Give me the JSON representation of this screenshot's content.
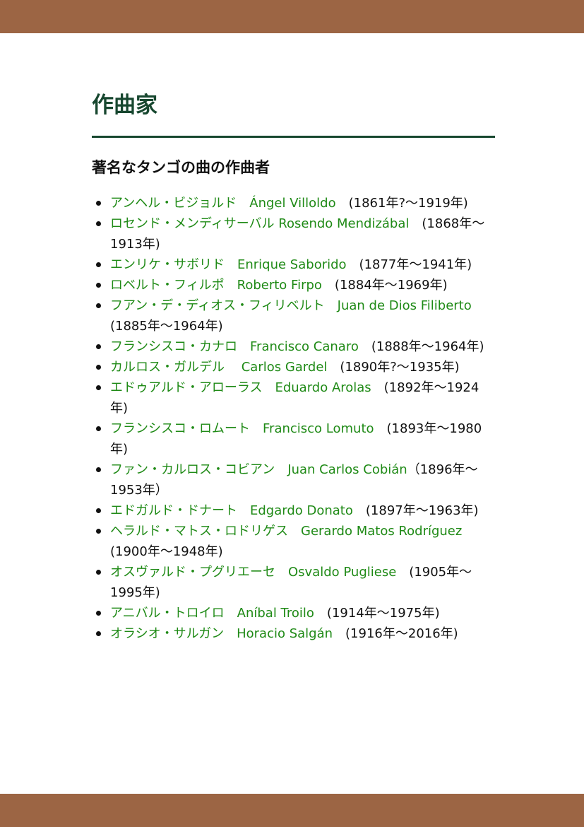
{
  "colors": {
    "band": "#9c6544",
    "title": "#17472f",
    "rule": "#17472f",
    "link": "#1f8a16",
    "text": "#111111"
  },
  "page": {
    "title": "作曲家",
    "section_title": "著名なタンゴの曲の作曲者"
  },
  "composers": [
    {
      "name": "アンヘル・ビジョルド　Ángel Villoldo",
      "years": "　(1861年?～1919年)"
    },
    {
      "name": "ロセンド・メンディサーバル Rosendo Mendizábal",
      "years": "　(1868年～1913年)"
    },
    {
      "name": "エンリケ・サボリド　Enrique Saborido",
      "years": "　(1877年～1941年)"
    },
    {
      "name": "ロベルト・フィルポ　Roberto Firpo",
      "years": "　(1884年～1969年)"
    },
    {
      "name": "フアン・デ・ディオス・フィリベルト　Juan de Dios Filiberto",
      "years": "　(1885年～1964年)"
    },
    {
      "name": "フランシスコ・カナロ　Francisco Canaro",
      "years": "　(1888年～1964年)"
    },
    {
      "name": "カルロス・ガルデル　 Carlos Gardel",
      "years": "　(1890年?～1935年)"
    },
    {
      "name": "エドゥアルド・アローラス　Eduardo Arolas",
      "years": "　(1892年～1924年)"
    },
    {
      "name": "フランシスコ・ロムート　Francisco Lomuto",
      "years": "　(1893年～1980年)"
    },
    {
      "name": "ファン・カルロス・コビアン　Juan Carlos Cobián",
      "years": "（1896年～1953年）"
    },
    {
      "name": "エドガルド・ドナート　Edgardo Donato",
      "years": "　(1897年～1963年)"
    },
    {
      "name": "ヘラルド・マトス・ロドリゲス　Gerardo Matos Rodríguez",
      "years": "　(1900年～1948年)"
    },
    {
      "name": "オスヴァルド・プグリエーセ　Osvaldo Pugliese",
      "years": "　(1905年～1995年)"
    },
    {
      "name": "アニバル・トロイロ　Aníbal Troilo",
      "years": "　(1914年～1975年)"
    },
    {
      "name": "オラシオ・サルガン　Horacio Salgán",
      "years": "　(1916年～2016年)"
    }
  ]
}
